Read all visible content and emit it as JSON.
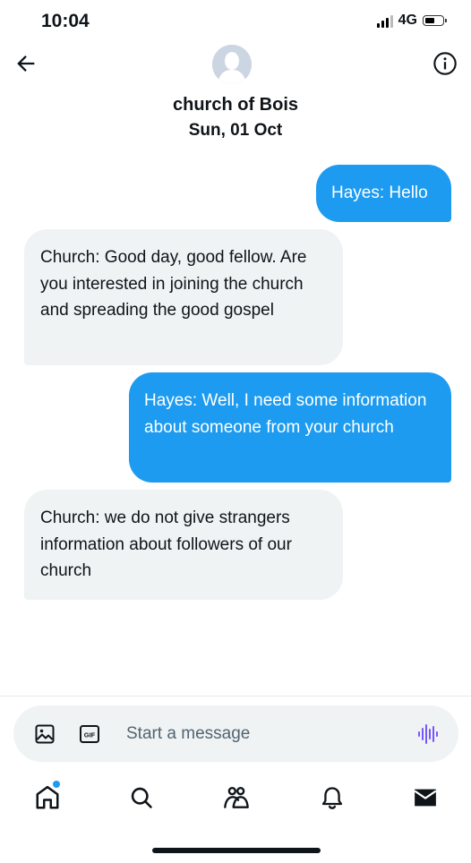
{
  "status_bar": {
    "time": "10:04",
    "network": "4G"
  },
  "header": {
    "title": "church of Bois",
    "date": "Sun, 01 Oct",
    "icons": {
      "back": "arrow-left-icon",
      "info": "info-icon",
      "avatar": "default-avatar"
    }
  },
  "messages": [
    {
      "direction": "outgoing",
      "text": "Hayes: Hello"
    },
    {
      "direction": "incoming",
      "text": "Church: Good day, good fellow. Are you interested in joining the church and spreading the good gospel"
    },
    {
      "direction": "outgoing",
      "text": "Hayes: Well, I need some information about someone from your church"
    },
    {
      "direction": "incoming",
      "text": "Church: we do not give strangers information about followers of our church"
    }
  ],
  "composer": {
    "placeholder": "Start a message",
    "value": "",
    "icons": [
      "image-icon",
      "gif-icon",
      "voice-icon"
    ]
  },
  "bottom_nav": {
    "items": [
      "home-icon",
      "search-icon",
      "communities-icon",
      "notifications-icon",
      "messages-icon"
    ],
    "active": "messages-icon"
  },
  "colors": {
    "accent": "#1d9bf0",
    "incoming_bubble": "#eff3f4",
    "text": "#0f1419",
    "muted": "#536471",
    "voice_icon": "#7856ff"
  }
}
